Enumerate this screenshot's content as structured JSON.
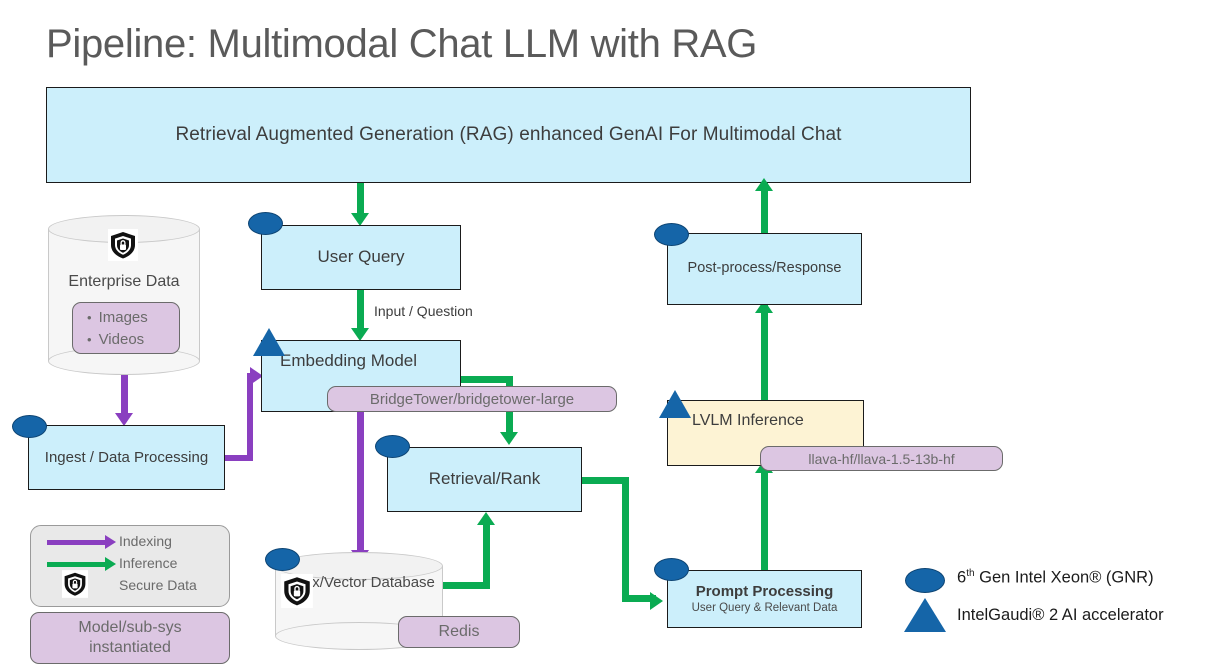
{
  "title": "Pipeline: Multimodal Chat LLM with RAG",
  "banner": {
    "text": "Retrieval Augmented Generation (RAG) enhanced GenAI For Multimodal Chat"
  },
  "nodes": {
    "enterprise_data": {
      "label": "Enterprise Data",
      "items": [
        "Images",
        "Videos"
      ],
      "secure_icon": "shield-lock-icon"
    },
    "ingest": {
      "label": "Ingest / Data Processing"
    },
    "user_query": {
      "label": "User Query"
    },
    "embedding_model": {
      "label": "Embedding Model",
      "model": "BridgeTower/bridgetower-large"
    },
    "retrieval_rank": {
      "label": "Retrieval/Rank"
    },
    "index_vector_db": {
      "label": "Index/Vector Database",
      "store": "Redis",
      "secure_icon": "shield-lock-icon"
    },
    "prompt_processing": {
      "label": "Prompt Processing",
      "sublabel": "User Query & Relevant Data"
    },
    "lvlm_inference": {
      "label": "LVLM Inference",
      "model": "llava-hf/llava-1.5-13b-hf"
    },
    "post_process": {
      "label": "Post-process/Response"
    }
  },
  "edges": {
    "input_question": "Input / Question"
  },
  "legend": {
    "indexing": "Indexing",
    "inference": "Inference",
    "secure_data": "Secure Data",
    "model_chip": "Model/sub-sys instantiated",
    "model_chip_l1": "Model/sub-sys",
    "model_chip_l2": "instantiated"
  },
  "hardware_legend": {
    "xeon_prefix": "6",
    "xeon_sup": "th",
    "xeon_rest": " Gen Intel Xeon® (GNR)",
    "gaudi": "IntelGaudi® 2 AI accelerator"
  },
  "colors": {
    "box_fill": "#ccefFB",
    "cream_fill": "#fdf3d4",
    "pill_fill": "#dcc6e2",
    "indexing_arrow": "#8a3fc0",
    "inference_arrow": "#0aab52",
    "xeon_marker": "#1565a8",
    "gaudi_marker": "#1565a8"
  }
}
